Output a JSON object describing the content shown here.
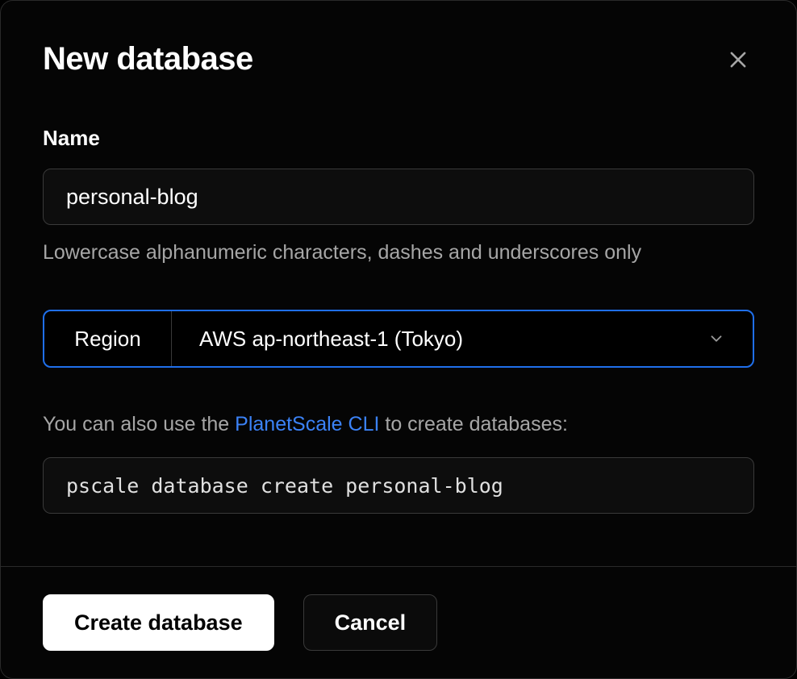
{
  "modal": {
    "title": "New database"
  },
  "name_field": {
    "label": "Name",
    "value": "personal-blog",
    "hint": "Lowercase alphanumeric characters, dashes and underscores only"
  },
  "region": {
    "label": "Region",
    "selected": "AWS ap-northeast-1 (Tokyo)"
  },
  "cli": {
    "prefix": "You can also use the ",
    "link_text": "PlanetScale CLI",
    "suffix": " to create databases:",
    "command": "pscale database create personal-blog"
  },
  "footer": {
    "primary": "Create database",
    "secondary": "Cancel"
  }
}
